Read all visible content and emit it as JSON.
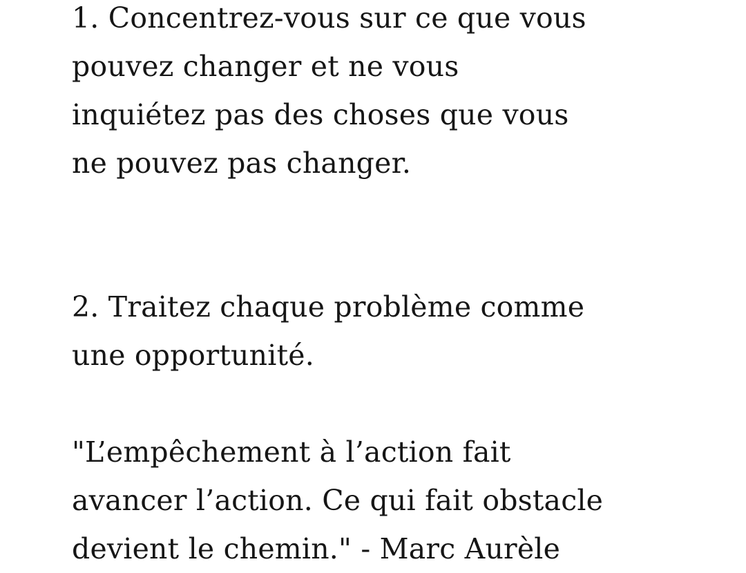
{
  "paragraphs": [
    "1. Concentrez-vous sur ce que vous\npouvez changer et ne vous\ninquiétez pas des choses que vous\nne pouvez pas changer.",
    "2. Traitez chaque problème comme\nune opportunité.",
    "\"L’empêchement à l’action fait\navancer l’action. Ce qui fait obstacle\ndevient le chemin.\" - Marc Aurèle"
  ]
}
